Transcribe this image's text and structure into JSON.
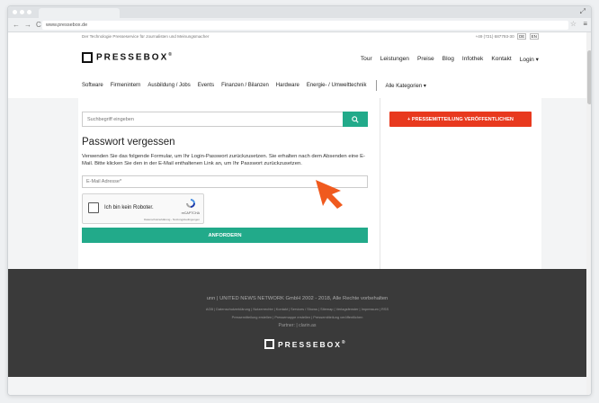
{
  "browser": {
    "url": "www.pressebox.de",
    "back_icon": "←",
    "forward_icon": "→",
    "reload_icon": "C",
    "star_icon": "☆",
    "menu_icon": "≡",
    "resize_icon": "⤢"
  },
  "topbar": {
    "tagline": "Der Technologie Presseservice für Journalisten und Meinungsmacher",
    "phone": "+49 (721) 687793-30",
    "lang_de": "DE",
    "lang_en": "EN"
  },
  "header": {
    "logo_text": "PRESSEBOX",
    "logo_reg": "®",
    "nav": [
      "Tour",
      "Leistungen",
      "Preise",
      "Blog",
      "Infothek",
      "Kontakt",
      "Login ▾"
    ]
  },
  "categories": {
    "items": [
      "Software",
      "Firmenintern",
      "Ausbildung / Jobs",
      "Events",
      "Finanzen / Bilanzen",
      "Hardware",
      "Energie- / Umwelttechnik"
    ],
    "all": "Alle Kategorien ▾"
  },
  "search": {
    "placeholder": "Suchbegriff eingeben",
    "button_icon": "🔍"
  },
  "cta": {
    "label": "+ PRESSEMITTEILUNG VERÖFFENTLICHEN"
  },
  "form": {
    "title": "Passwort vergessen",
    "description": "Verwenden Sie das folgende Formular, um Ihr Login-Passwort zurückzusetzen. Sie erhalten nach dem Absenden eine E-Mail. Bitte klicken Sie den in der E-Mail enthaltenen Link an, um Ihr Passwort zurückzusetzen.",
    "email_placeholder": "E-Mail Adresse*",
    "recaptcha_label": "Ich bin kein Roboter.",
    "recaptcha_brand": "reCAPTCHA",
    "recaptcha_terms": "Datenschutzerklärung - Nutzungsbedingungen",
    "submit": "ANFORDERN"
  },
  "footer": {
    "copyright": "unn | UNITED NEWS NETWORK GmbH 2002 - 2018, Alle Rechte vorbehalten",
    "links1": "AGB | Datenschutzerklärung | Nutzerrechte | Kontakt | Services / Shows | Sitemap | Verlagsfenster | Impressum | RSS",
    "links2": "Pressemitteilung erstellen | Pressemappe erstellen | Pressemitteilung veröffentlichen",
    "partner": "Partner: | clarin.as",
    "logo_text": "PRESSEBOX",
    "logo_reg": "®"
  },
  "colors": {
    "accent_green": "#22aa8a",
    "accent_red": "#e8391e",
    "footer_bg": "#3a3a3a"
  }
}
